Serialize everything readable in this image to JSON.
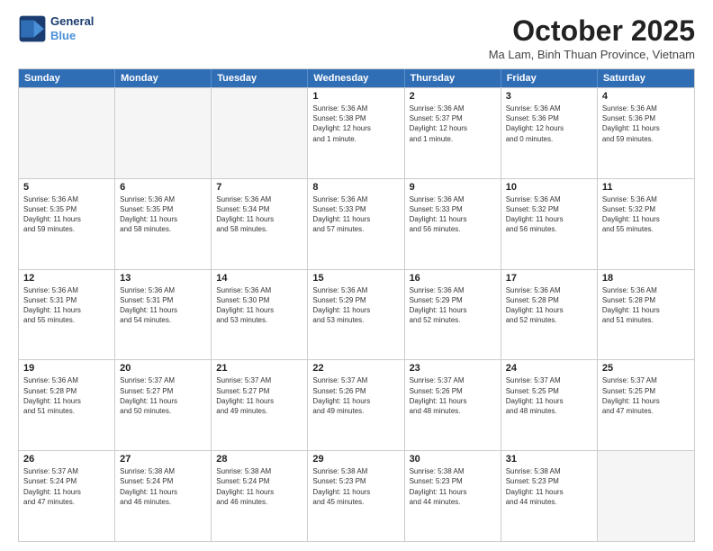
{
  "header": {
    "logo_line1": "General",
    "logo_line2": "Blue",
    "month": "October 2025",
    "location": "Ma Lam, Binh Thuan Province, Vietnam"
  },
  "day_headers": [
    "Sunday",
    "Monday",
    "Tuesday",
    "Wednesday",
    "Thursday",
    "Friday",
    "Saturday"
  ],
  "weeks": [
    [
      {
        "day": "",
        "info": ""
      },
      {
        "day": "",
        "info": ""
      },
      {
        "day": "",
        "info": ""
      },
      {
        "day": "1",
        "info": "Sunrise: 5:36 AM\nSunset: 5:38 PM\nDaylight: 12 hours\nand 1 minute."
      },
      {
        "day": "2",
        "info": "Sunrise: 5:36 AM\nSunset: 5:37 PM\nDaylight: 12 hours\nand 1 minute."
      },
      {
        "day": "3",
        "info": "Sunrise: 5:36 AM\nSunset: 5:36 PM\nDaylight: 12 hours\nand 0 minutes."
      },
      {
        "day": "4",
        "info": "Sunrise: 5:36 AM\nSunset: 5:36 PM\nDaylight: 11 hours\nand 59 minutes."
      }
    ],
    [
      {
        "day": "5",
        "info": "Sunrise: 5:36 AM\nSunset: 5:35 PM\nDaylight: 11 hours\nand 59 minutes."
      },
      {
        "day": "6",
        "info": "Sunrise: 5:36 AM\nSunset: 5:35 PM\nDaylight: 11 hours\nand 58 minutes."
      },
      {
        "day": "7",
        "info": "Sunrise: 5:36 AM\nSunset: 5:34 PM\nDaylight: 11 hours\nand 58 minutes."
      },
      {
        "day": "8",
        "info": "Sunrise: 5:36 AM\nSunset: 5:33 PM\nDaylight: 11 hours\nand 57 minutes."
      },
      {
        "day": "9",
        "info": "Sunrise: 5:36 AM\nSunset: 5:33 PM\nDaylight: 11 hours\nand 56 minutes."
      },
      {
        "day": "10",
        "info": "Sunrise: 5:36 AM\nSunset: 5:32 PM\nDaylight: 11 hours\nand 56 minutes."
      },
      {
        "day": "11",
        "info": "Sunrise: 5:36 AM\nSunset: 5:32 PM\nDaylight: 11 hours\nand 55 minutes."
      }
    ],
    [
      {
        "day": "12",
        "info": "Sunrise: 5:36 AM\nSunset: 5:31 PM\nDaylight: 11 hours\nand 55 minutes."
      },
      {
        "day": "13",
        "info": "Sunrise: 5:36 AM\nSunset: 5:31 PM\nDaylight: 11 hours\nand 54 minutes."
      },
      {
        "day": "14",
        "info": "Sunrise: 5:36 AM\nSunset: 5:30 PM\nDaylight: 11 hours\nand 53 minutes."
      },
      {
        "day": "15",
        "info": "Sunrise: 5:36 AM\nSunset: 5:29 PM\nDaylight: 11 hours\nand 53 minutes."
      },
      {
        "day": "16",
        "info": "Sunrise: 5:36 AM\nSunset: 5:29 PM\nDaylight: 11 hours\nand 52 minutes."
      },
      {
        "day": "17",
        "info": "Sunrise: 5:36 AM\nSunset: 5:28 PM\nDaylight: 11 hours\nand 52 minutes."
      },
      {
        "day": "18",
        "info": "Sunrise: 5:36 AM\nSunset: 5:28 PM\nDaylight: 11 hours\nand 51 minutes."
      }
    ],
    [
      {
        "day": "19",
        "info": "Sunrise: 5:36 AM\nSunset: 5:28 PM\nDaylight: 11 hours\nand 51 minutes."
      },
      {
        "day": "20",
        "info": "Sunrise: 5:37 AM\nSunset: 5:27 PM\nDaylight: 11 hours\nand 50 minutes."
      },
      {
        "day": "21",
        "info": "Sunrise: 5:37 AM\nSunset: 5:27 PM\nDaylight: 11 hours\nand 49 minutes."
      },
      {
        "day": "22",
        "info": "Sunrise: 5:37 AM\nSunset: 5:26 PM\nDaylight: 11 hours\nand 49 minutes."
      },
      {
        "day": "23",
        "info": "Sunrise: 5:37 AM\nSunset: 5:26 PM\nDaylight: 11 hours\nand 48 minutes."
      },
      {
        "day": "24",
        "info": "Sunrise: 5:37 AM\nSunset: 5:25 PM\nDaylight: 11 hours\nand 48 minutes."
      },
      {
        "day": "25",
        "info": "Sunrise: 5:37 AM\nSunset: 5:25 PM\nDaylight: 11 hours\nand 47 minutes."
      }
    ],
    [
      {
        "day": "26",
        "info": "Sunrise: 5:37 AM\nSunset: 5:24 PM\nDaylight: 11 hours\nand 47 minutes."
      },
      {
        "day": "27",
        "info": "Sunrise: 5:38 AM\nSunset: 5:24 PM\nDaylight: 11 hours\nand 46 minutes."
      },
      {
        "day": "28",
        "info": "Sunrise: 5:38 AM\nSunset: 5:24 PM\nDaylight: 11 hours\nand 46 minutes."
      },
      {
        "day": "29",
        "info": "Sunrise: 5:38 AM\nSunset: 5:23 PM\nDaylight: 11 hours\nand 45 minutes."
      },
      {
        "day": "30",
        "info": "Sunrise: 5:38 AM\nSunset: 5:23 PM\nDaylight: 11 hours\nand 44 minutes."
      },
      {
        "day": "31",
        "info": "Sunrise: 5:38 AM\nSunset: 5:23 PM\nDaylight: 11 hours\nand 44 minutes."
      },
      {
        "day": "",
        "info": ""
      }
    ]
  ]
}
